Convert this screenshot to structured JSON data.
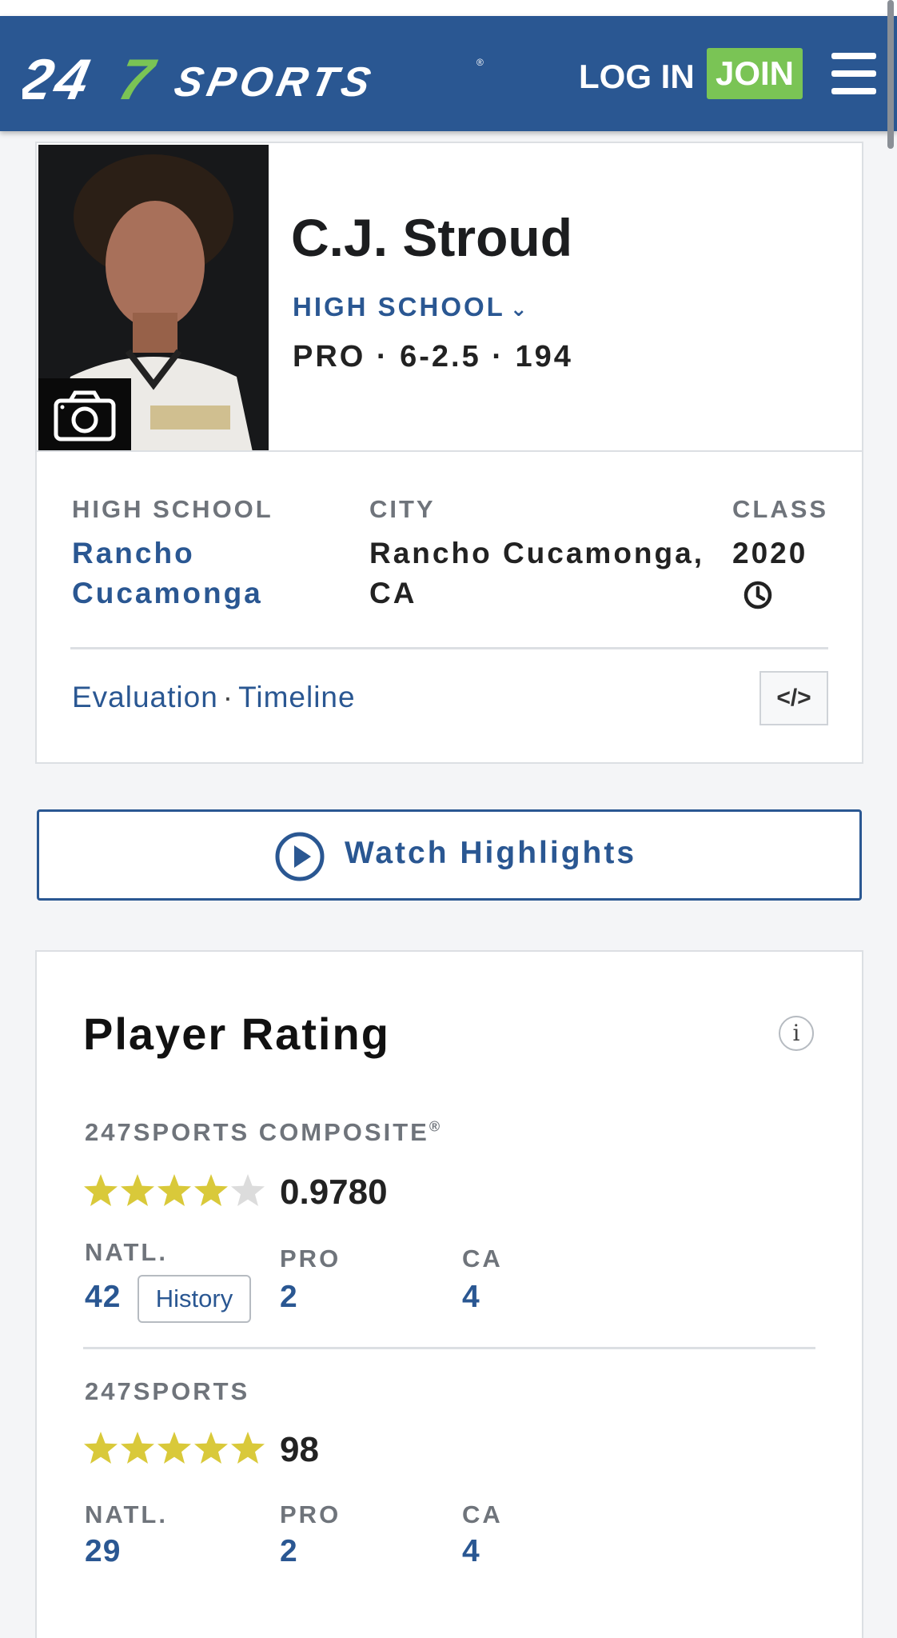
{
  "header": {
    "logo_text": "247SPORTS",
    "login_label": "LOG IN",
    "join_label": "JOIN",
    "menu_icon": "hamburger-menu-icon",
    "colors": {
      "header_bg": "#2a5792",
      "join_bg": "#7ac455"
    }
  },
  "player": {
    "name": "C.J. Stroud",
    "view_selector": "HIGH SCHOOL",
    "measurements": "PRO · 6-2.5 · 194",
    "photo_icon": "camera-icon"
  },
  "info": {
    "high_school_label": "HIGH SCHOOL",
    "high_school_value": "Rancho Cucamonga",
    "city_label": "CITY",
    "city_value": "Rancho Cucamonga, CA",
    "class_label": "CLASS",
    "class_value": "2020",
    "class_icon": "clock-icon"
  },
  "links": {
    "evaluation": "Evaluation",
    "separator": "·",
    "timeline": "Timeline",
    "embed_label": "</>"
  },
  "highlights": {
    "label": "Watch Highlights",
    "icon": "play-circle-icon"
  },
  "rating": {
    "title": "Player Rating",
    "info_icon": "i",
    "composite": {
      "label": "247SPORTS COMPOSITE",
      "mark": "®",
      "stars_filled": 4,
      "stars_total": 5,
      "score": "0.9780",
      "natl_label": "NATL.",
      "natl_value": "42",
      "history_label": "History",
      "pos_label": "PRO",
      "pos_value": "2",
      "state_label": "CA",
      "state_value": "4"
    },
    "sports247": {
      "label": "247SPORTS",
      "stars_filled": 5,
      "stars_total": 5,
      "score": "98",
      "natl_label": "NATL.",
      "natl_value": "29",
      "pos_label": "PRO",
      "pos_value": "2",
      "state_label": "CA",
      "state_value": "4"
    },
    "colors": {
      "star_filled": "#d9c93a",
      "star_empty": "#dcdcdc"
    }
  }
}
